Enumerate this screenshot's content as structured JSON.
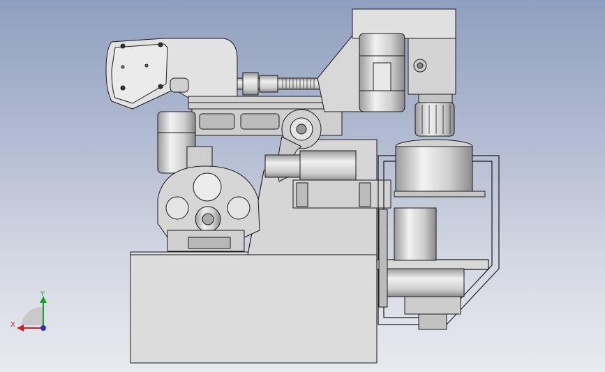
{
  "view": {
    "background_top": "#8f9fbf",
    "background_bottom": "#e9eaef",
    "part_fill": "#d9d9d9",
    "part_fill_light": "#e6e6e6",
    "part_fill_dark": "#bdbdbd",
    "edge_color": "#1a1a1a"
  },
  "triad": {
    "x_label": "X",
    "y_label": "Y",
    "x_color": "#d0202a",
    "y_color": "#16a32a",
    "z_color": "#2633c9"
  }
}
